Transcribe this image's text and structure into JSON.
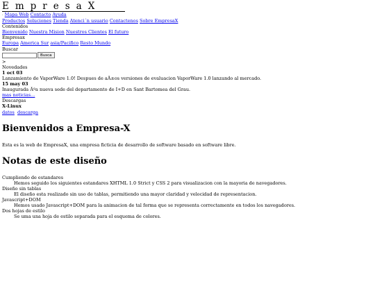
{
  "logo": {
    "text": "EmpresaX"
  },
  "top_nav": {
    "bullet": "·",
    "items": [
      "Mapa Web",
      "Contacto",
      "Ayuda"
    ]
  },
  "main_nav": {
    "items": [
      "Productos",
      "Soluciones",
      "Tienda",
      "Atenci´n usuario",
      "Contactenos",
      "Sobre EmpresaX"
    ]
  },
  "contents": {
    "title": "Contenidos",
    "items": [
      "Bienvenido",
      "Nuestra Mision",
      "Nuestros Clientes",
      "El futuro"
    ]
  },
  "regions": {
    "title": "Empresax",
    "items": [
      "Europa",
      "America Sur",
      "asia/Pacifico",
      "Resto Mundo"
    ]
  },
  "search": {
    "title": "Buscar",
    "value": "",
    "placeholder": "",
    "button_label": "Busca",
    "arrow": ">"
  },
  "news": {
    "title": "Novedades",
    "items": [
      {
        "date": "1 oct 03",
        "text": "Lanzamiento de VaporWare 1.0! Despues de aÃ±os versiones de evaluacion VaporWare 1.0 lanzando al mercado."
      },
      {
        "date": "15 may 03",
        "text": "Inaugurada Ãºa nueva sede del departamento de I+D en Sant Bartomea del Grau."
      }
    ],
    "more_link": "mas noticias..."
  },
  "downloads": {
    "title": "Descargas",
    "product": "X-Linux",
    "links": [
      "datos",
      "descarga"
    ]
  },
  "main": {
    "heading": "Bienvenidos a Empresa-X",
    "intro": "Esta es la web de EmpresaX, una empresa ficticia de desarrollo de software basado en software libre.",
    "notes_heading": "Notas de este diseño",
    "notes": [
      {
        "term": "Cumpliendo de estandares",
        "desc": "Hemos seguido los siguientes estandares XHTML 1.0 Strict y CSS 2 para visualizacion con la mayoria de navegadores."
      },
      {
        "term": "Diseño sin tablas",
        "desc": "El diseño esta realizado sin uso de tablas, permitiendo una mayor claridad y velocidad de representacion."
      },
      {
        "term": "Javascript+DOM",
        "desc": "Hemos usado Javascript+DOM para la animacion de tal forma que se representa correctamente en todos los navegadores."
      },
      {
        "term": "Dos hojas de estilo",
        "desc": "Se uma una hoja de estilo separada para el esquema de colores."
      }
    ]
  }
}
